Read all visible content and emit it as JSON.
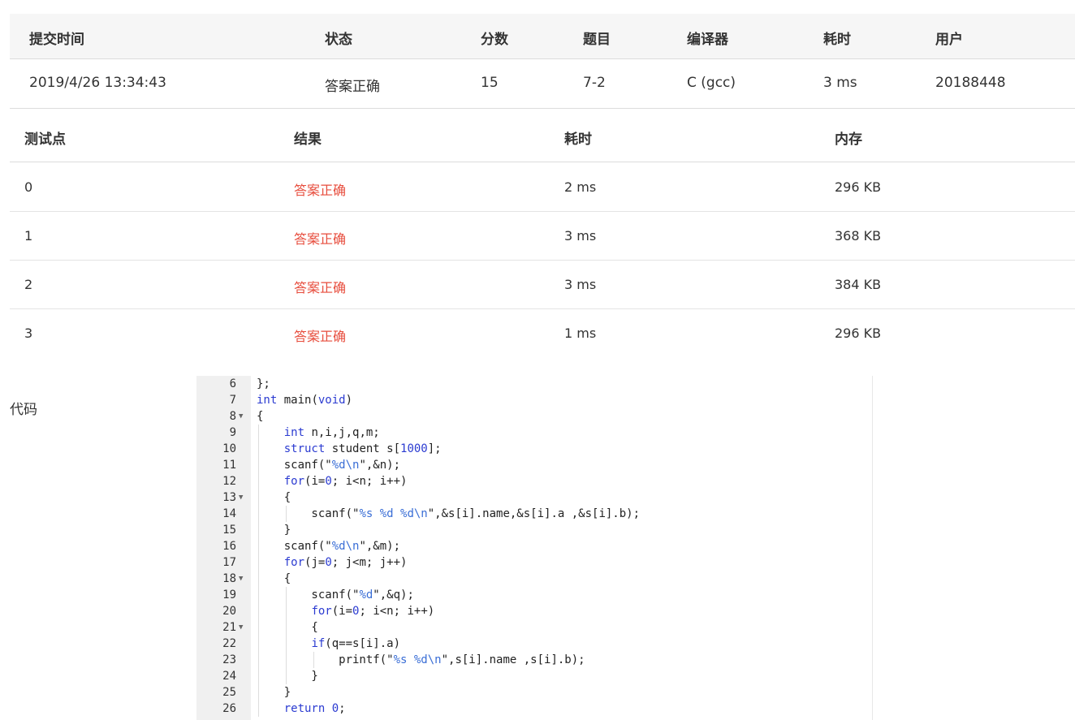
{
  "submission": {
    "headers": {
      "time": "提交时间",
      "status": "状态",
      "score": "分数",
      "problem": "题目",
      "compiler": "编译器",
      "duration": "耗时",
      "user": "用户"
    },
    "row": {
      "time": "2019/4/26 13:34:43",
      "status": "答案正确",
      "score": "15",
      "problem": "7-2",
      "compiler": "C (gcc)",
      "duration": "3 ms",
      "user": "20188448"
    }
  },
  "testpoints": {
    "headers": {
      "point": "测试点",
      "result": "结果",
      "duration": "耗时",
      "memory": "内存"
    },
    "rows": [
      {
        "point": "0",
        "result": "答案正确",
        "duration": "2 ms",
        "memory": "296 KB"
      },
      {
        "point": "1",
        "result": "答案正确",
        "duration": "3 ms",
        "memory": "368 KB"
      },
      {
        "point": "2",
        "result": "答案正确",
        "duration": "3 ms",
        "memory": "384 KB"
      },
      {
        "point": "3",
        "result": "答案正确",
        "duration": "1 ms",
        "memory": "296 KB"
      }
    ]
  },
  "code": {
    "label": "代码",
    "lines": [
      {
        "n": "6",
        "text": "};"
      },
      {
        "n": "7",
        "text": "int main(void)"
      },
      {
        "n": "8",
        "text": "{"
      },
      {
        "n": "9",
        "text": "    int n,i,j,q,m;"
      },
      {
        "n": "10",
        "text": "    struct student s[1000];"
      },
      {
        "n": "11",
        "text": "    scanf(\"%d\\n\",&n);"
      },
      {
        "n": "12",
        "text": "    for(i=0; i<n; i++)"
      },
      {
        "n": "13",
        "text": "    {"
      },
      {
        "n": "14",
        "text": "        scanf(\"%s %d %d\\n\",&s[i].name,&s[i].a ,&s[i].b);"
      },
      {
        "n": "15",
        "text": "    }"
      },
      {
        "n": "16",
        "text": "    scanf(\"%d\\n\",&m);"
      },
      {
        "n": "17",
        "text": "    for(j=0; j<m; j++)"
      },
      {
        "n": "18",
        "text": "    {"
      },
      {
        "n": "19",
        "text": "        scanf(\"%d\",&q);"
      },
      {
        "n": "20",
        "text": "        for(i=0; i<n; i++)"
      },
      {
        "n": "21",
        "text": "        {"
      },
      {
        "n": "22",
        "text": "        if(q==s[i].a)"
      },
      {
        "n": "23",
        "text": "            printf(\"%s %d\\n\",s[i].name ,s[i].b);"
      },
      {
        "n": "24",
        "text": "        }"
      },
      {
        "n": "25",
        "text": "    }"
      },
      {
        "n": "26",
        "text": "    return 0;"
      }
    ],
    "fold_marker": "▼",
    "folds": [
      "8",
      "13",
      "18",
      "21"
    ]
  },
  "colors": {
    "ok": "#e74c3c",
    "link": "#1f5a99",
    "keyword": "#2b3bd1"
  }
}
